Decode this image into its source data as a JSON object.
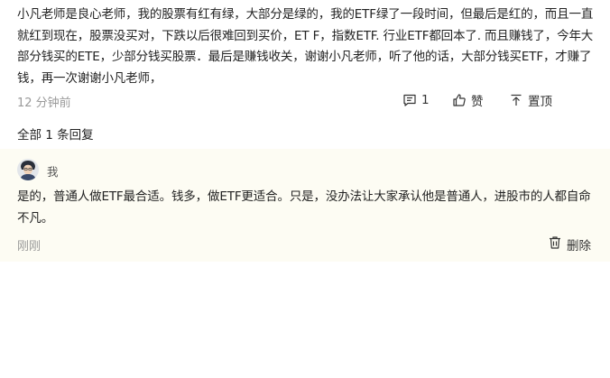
{
  "comment": {
    "text": "小凡老师是良心老师，我的股票有红有绿，大部分是绿的，我的ETF绿了一段时间，但最后是红的，而且一直就红到现在，股票没买对，下跌以后很难回到买价，ET F，指数ETF. 行业ETF都回本了. 而且赚钱了，今年大部分钱买的ETE，少部分钱买股票．最后是赚钱收关，谢谢小凡老师，听了他的话，大部分钱买ETF，才赚了钱，再一次谢谢小凡老师，",
    "time": "12 分钟前",
    "reply_count": "1",
    "like_label": "赞",
    "pin_label": "置顶"
  },
  "replies_header": "全部 1 条回复",
  "reply": {
    "author": "我",
    "text": "是的，普通人做ETF最合适。钱多，做ETF更适合。只是，没办法让大家承认他是普通人，进股市的人都自命不凡。",
    "time": "刚刚",
    "delete_label": "删除"
  },
  "colors": {
    "text": "#222222",
    "meta": "#9a9a9a",
    "reply_background": "#fdfcf3"
  },
  "icons": [
    "comment-icon",
    "thumbs-up-icon",
    "pin-top-icon",
    "trash-icon",
    "user-avatar"
  ]
}
